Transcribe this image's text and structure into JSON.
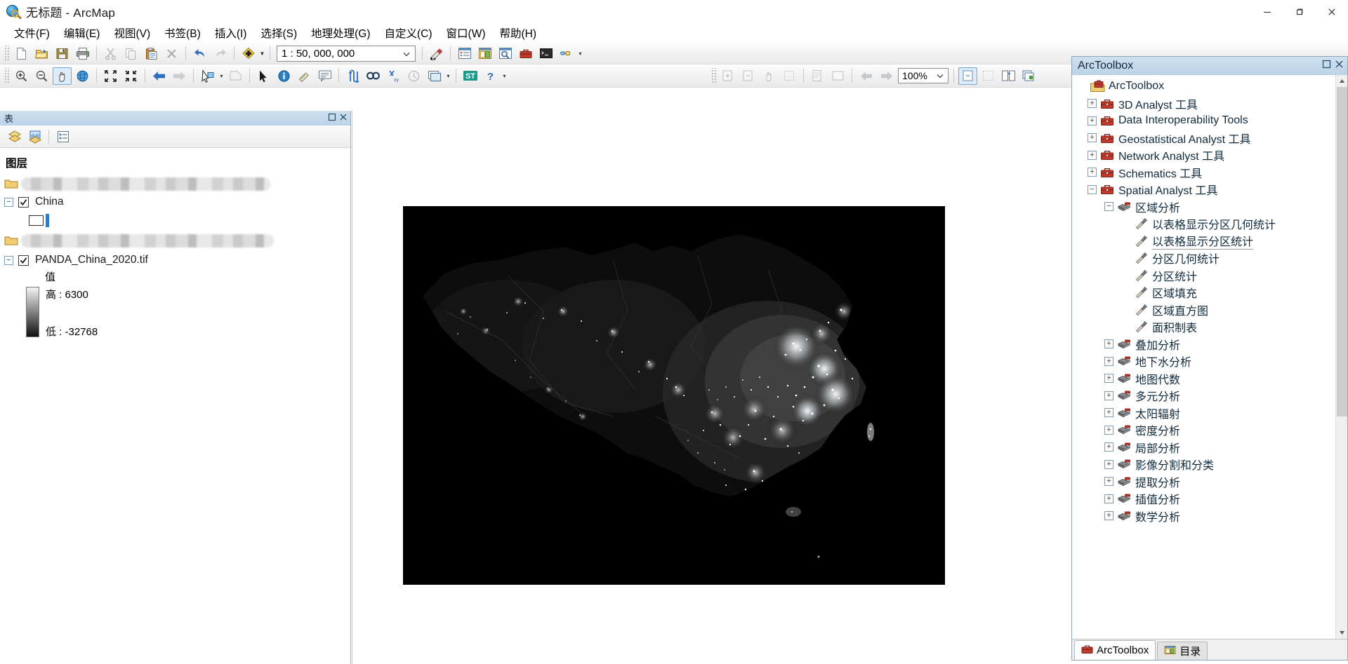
{
  "window": {
    "title": "无标题 - ArcMap",
    "app_icon": "arcmap-globe-icon",
    "minimize": "minimize-button",
    "maximize": "maximize-button",
    "close": "close-button"
  },
  "menu": {
    "items": [
      {
        "label": "文件(F)",
        "name": "menu-file"
      },
      {
        "label": "编辑(E)",
        "name": "menu-edit"
      },
      {
        "label": "视图(V)",
        "name": "menu-view"
      },
      {
        "label": "书签(B)",
        "name": "menu-bookmarks"
      },
      {
        "label": "插入(I)",
        "name": "menu-insert"
      },
      {
        "label": "选择(S)",
        "name": "menu-selection"
      },
      {
        "label": "地理处理(G)",
        "name": "menu-geoprocessing"
      },
      {
        "label": "自定义(C)",
        "name": "menu-customize"
      },
      {
        "label": "窗口(W)",
        "name": "menu-window"
      },
      {
        "label": "帮助(H)",
        "name": "menu-help"
      }
    ]
  },
  "standard_toolbar": {
    "scale_value": "1 : 50, 000, 000",
    "buttons": [
      "new-document-icon",
      "open-folder-icon",
      "save-icon",
      "print-icon",
      "cut-icon",
      "copy-icon",
      "paste-icon",
      "delete-icon",
      "undo-icon",
      "redo-icon",
      "add-data-icon"
    ],
    "after_scale": [
      "editor-toolbar-icon",
      "table-of-contents-icon",
      "catalog-icon",
      "search-icon",
      "arctoolbox-icon",
      "python-window-icon",
      "model-builder-icon"
    ]
  },
  "tools_toolbar": {
    "buttons": [
      "zoom-in-icon",
      "zoom-out-icon",
      "pan-icon",
      "full-extent-icon",
      "fixed-zoom-in-icon",
      "fixed-zoom-out-icon",
      "go-back-extent-icon",
      "go-forward-extent-icon",
      "select-features-icon",
      "clear-selection-icon",
      "select-elements-icon",
      "identify-icon",
      "measure-icon",
      "html-popup-icon",
      "find-route-icon",
      "find-icon",
      "go-to-xy-icon",
      "time-slider-icon",
      "create-viewer-window-icon",
      "st-icon",
      "help-icon"
    ]
  },
  "layout_toolbar": {
    "zoom_value": "100%",
    "buttons": [
      "zoom-in-page-icon",
      "zoom-out-page-icon",
      "pan-page-icon",
      "fixed-zoom-page-icon",
      "whole-page-icon",
      "page-width-icon",
      "previous-extent-page-icon",
      "next-extent-page-icon",
      "zoom-to-percent-icon",
      "toggle-draft-mode-icon",
      "focus-data-frame-icon",
      "change-layout-icon",
      "data-driven-pages-icon"
    ]
  },
  "toc": {
    "caption": "表",
    "caption_float": "float-button",
    "caption_close": "close-button",
    "toolbar_buttons": [
      "list-by-drawing-order-icon",
      "list-by-source-icon",
      "list-by-selection-icon"
    ],
    "heading": "图层",
    "layers": [
      {
        "name": "redacted-group-1",
        "label": "",
        "redacted": true
      },
      {
        "name": "layer-china",
        "label": "China",
        "checked": true,
        "expanded": true
      },
      {
        "name": "redacted-group-2",
        "label": "",
        "redacted": true
      },
      {
        "name": "layer-panda-raster",
        "label": "PANDA_China_2020.tif",
        "checked": true,
        "expanded": true
      }
    ],
    "raster_legend": {
      "title": "值",
      "high": "高 : 6300",
      "low": "低 : -32768"
    }
  },
  "map": {
    "name": "china-nighttime-lights-map",
    "description": "PANDA China 2020 nighttime lights raster over China boundary"
  },
  "toolbox": {
    "caption": "ArcToolbox",
    "caption_float": "float-button",
    "caption_close": "close-button",
    "root": {
      "label": "ArcToolbox",
      "icon": "arctoolbox-root-icon",
      "indent": 0,
      "state": "none"
    },
    "nodes": [
      {
        "label": "3D Analyst 工具",
        "icon": "toolbox-icon",
        "indent": 1,
        "state": "collapsed",
        "name": "toolbox-3d-analyst"
      },
      {
        "label": "Data Interoperability Tools",
        "icon": "toolbox-icon",
        "indent": 1,
        "state": "collapsed",
        "name": "toolbox-data-interoperability"
      },
      {
        "label": "Geostatistical Analyst 工具",
        "icon": "toolbox-icon",
        "indent": 1,
        "state": "collapsed",
        "name": "toolbox-geostatistical-analyst"
      },
      {
        "label": "Network Analyst 工具",
        "icon": "toolbox-icon",
        "indent": 1,
        "state": "collapsed",
        "name": "toolbox-network-analyst"
      },
      {
        "label": "Schematics 工具",
        "icon": "toolbox-icon",
        "indent": 1,
        "state": "collapsed",
        "name": "toolbox-schematics"
      },
      {
        "label": "Spatial Analyst 工具",
        "icon": "toolbox-icon",
        "indent": 1,
        "state": "expanded",
        "name": "toolbox-spatial-analyst"
      },
      {
        "label": "区域分析",
        "icon": "toolset-icon",
        "indent": 2,
        "state": "expanded",
        "name": "toolset-zonal"
      },
      {
        "label": "以表格显示分区几何统计",
        "icon": "tool-icon",
        "indent": 3,
        "state": "none",
        "name": "tool-zonal-geometry-as-table"
      },
      {
        "label": "以表格显示分区统计",
        "icon": "tool-icon",
        "indent": 3,
        "state": "none",
        "name": "tool-zonal-statistics-as-table",
        "selected": true
      },
      {
        "label": "分区几何统计",
        "icon": "tool-icon",
        "indent": 3,
        "state": "none",
        "name": "tool-zonal-geometry"
      },
      {
        "label": "分区统计",
        "icon": "tool-icon",
        "indent": 3,
        "state": "none",
        "name": "tool-zonal-statistics"
      },
      {
        "label": "区域填充",
        "icon": "tool-icon",
        "indent": 3,
        "state": "none",
        "name": "tool-zonal-fill"
      },
      {
        "label": "区域直方图",
        "icon": "tool-icon",
        "indent": 3,
        "state": "none",
        "name": "tool-zonal-histogram"
      },
      {
        "label": "面积制表",
        "icon": "tool-icon",
        "indent": 3,
        "state": "none",
        "name": "tool-tabulate-area"
      },
      {
        "label": "叠加分析",
        "icon": "toolset-icon",
        "indent": 2,
        "state": "collapsed",
        "name": "toolset-overlay"
      },
      {
        "label": "地下水分析",
        "icon": "toolset-icon",
        "indent": 2,
        "state": "collapsed",
        "name": "toolset-groundwater"
      },
      {
        "label": "地图代数",
        "icon": "toolset-icon",
        "indent": 2,
        "state": "collapsed",
        "name": "toolset-map-algebra"
      },
      {
        "label": "多元分析",
        "icon": "toolset-icon",
        "indent": 2,
        "state": "collapsed",
        "name": "toolset-multivariate"
      },
      {
        "label": "太阳辐射",
        "icon": "toolset-icon",
        "indent": 2,
        "state": "collapsed",
        "name": "toolset-solar-radiation"
      },
      {
        "label": "密度分析",
        "icon": "toolset-icon",
        "indent": 2,
        "state": "collapsed",
        "name": "toolset-density"
      },
      {
        "label": "局部分析",
        "icon": "toolset-icon",
        "indent": 2,
        "state": "collapsed",
        "name": "toolset-local"
      },
      {
        "label": "影像分割和分类",
        "icon": "toolset-icon",
        "indent": 2,
        "state": "collapsed",
        "name": "toolset-segmentation-classification"
      },
      {
        "label": "提取分析",
        "icon": "toolset-icon",
        "indent": 2,
        "state": "collapsed",
        "name": "toolset-extraction"
      },
      {
        "label": "插值分析",
        "icon": "toolset-icon",
        "indent": 2,
        "state": "collapsed",
        "name": "toolset-interpolation"
      },
      {
        "label": "数学分析",
        "icon": "toolset-icon",
        "indent": 2,
        "state": "collapsed",
        "name": "toolset-math"
      }
    ],
    "tabs": [
      {
        "label": "ArcToolbox",
        "icon": "arctoolbox-tab-icon",
        "active": true,
        "name": "tab-arctoolbox"
      },
      {
        "label": "目录",
        "icon": "catalog-tab-icon",
        "active": false,
        "name": "tab-catalog"
      }
    ]
  },
  "colors": {
    "caption_bg": "#bcd3e6",
    "accent_blue": "#1a7fe0",
    "toolbox_red": "#c0392b",
    "map_bg": "#000000"
  }
}
